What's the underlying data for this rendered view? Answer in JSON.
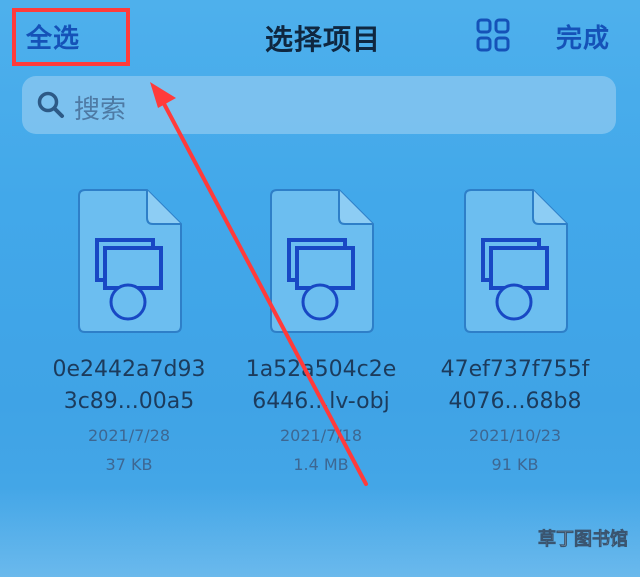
{
  "nav": {
    "select_all": "全选",
    "title": "选择项目",
    "done": "完成"
  },
  "search": {
    "placeholder": "搜索"
  },
  "files": [
    {
      "name_line1": "0e2442a7d93",
      "name_line2": "3c89...00a5",
      "date": "2021/7/28",
      "size": "37 KB"
    },
    {
      "name_line1": "1a52a504c2e",
      "name_line2": "6446...lv-obj",
      "date": "2021/7/18",
      "size": "1.4 MB"
    },
    {
      "name_line1": "47ef737f755f",
      "name_line2": "4076...68b8",
      "date": "2021/10/23",
      "size": "91 KB"
    }
  ],
  "watermark": {
    "text": "草丁图书馆"
  },
  "colors": {
    "accent": "#1552b8",
    "annotation": "#ff3b3b",
    "background": "#42a8ea"
  },
  "icons": {
    "view": "grid-icon",
    "search": "search-icon",
    "file": "file-icon"
  }
}
